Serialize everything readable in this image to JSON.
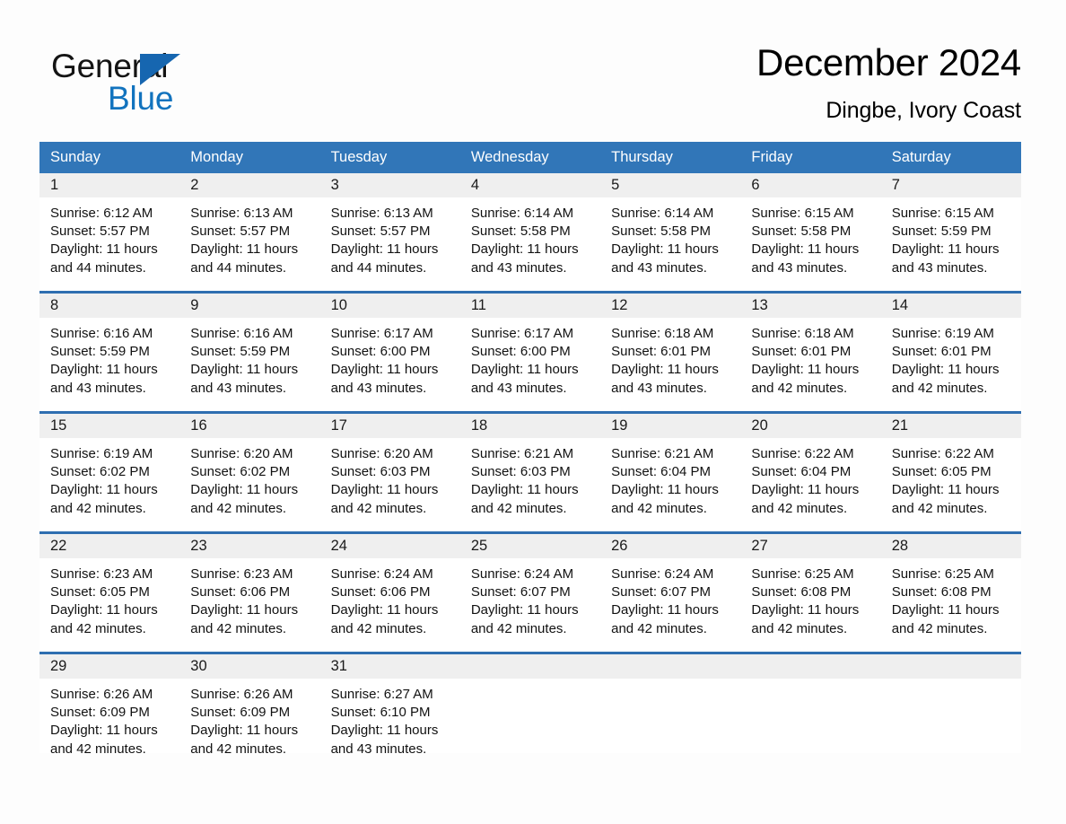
{
  "brand": {
    "name_part1": "General",
    "name_part2": "Blue",
    "triangle_color": "#1666b0",
    "blue_text_color": "#1273be"
  },
  "header": {
    "title": "December 2024",
    "subtitle": "Dingbe, Ivory Coast"
  },
  "theme": {
    "header_blue": "#3176b8",
    "row_separator_blue": "#2e6eb0",
    "daynum_band_gray": "#efefef",
    "page_background": "#fdfdfd"
  },
  "calendar": {
    "weekday_headers": [
      "Sunday",
      "Monday",
      "Tuesday",
      "Wednesday",
      "Thursday",
      "Friday",
      "Saturday"
    ],
    "weeks": [
      [
        {
          "day": "1",
          "sunrise": "Sunrise: 6:12 AM",
          "sunset": "Sunset: 5:57 PM",
          "daylight_line1": "Daylight: 11 hours",
          "daylight_line2": "and 44 minutes."
        },
        {
          "day": "2",
          "sunrise": "Sunrise: 6:13 AM",
          "sunset": "Sunset: 5:57 PM",
          "daylight_line1": "Daylight: 11 hours",
          "daylight_line2": "and 44 minutes."
        },
        {
          "day": "3",
          "sunrise": "Sunrise: 6:13 AM",
          "sunset": "Sunset: 5:57 PM",
          "daylight_line1": "Daylight: 11 hours",
          "daylight_line2": "and 44 minutes."
        },
        {
          "day": "4",
          "sunrise": "Sunrise: 6:14 AM",
          "sunset": "Sunset: 5:58 PM",
          "daylight_line1": "Daylight: 11 hours",
          "daylight_line2": "and 43 minutes."
        },
        {
          "day": "5",
          "sunrise": "Sunrise: 6:14 AM",
          "sunset": "Sunset: 5:58 PM",
          "daylight_line1": "Daylight: 11 hours",
          "daylight_line2": "and 43 minutes."
        },
        {
          "day": "6",
          "sunrise": "Sunrise: 6:15 AM",
          "sunset": "Sunset: 5:58 PM",
          "daylight_line1": "Daylight: 11 hours",
          "daylight_line2": "and 43 minutes."
        },
        {
          "day": "7",
          "sunrise": "Sunrise: 6:15 AM",
          "sunset": "Sunset: 5:59 PM",
          "daylight_line1": "Daylight: 11 hours",
          "daylight_line2": "and 43 minutes."
        }
      ],
      [
        {
          "day": "8",
          "sunrise": "Sunrise: 6:16 AM",
          "sunset": "Sunset: 5:59 PM",
          "daylight_line1": "Daylight: 11 hours",
          "daylight_line2": "and 43 minutes."
        },
        {
          "day": "9",
          "sunrise": "Sunrise: 6:16 AM",
          "sunset": "Sunset: 5:59 PM",
          "daylight_line1": "Daylight: 11 hours",
          "daylight_line2": "and 43 minutes."
        },
        {
          "day": "10",
          "sunrise": "Sunrise: 6:17 AM",
          "sunset": "Sunset: 6:00 PM",
          "daylight_line1": "Daylight: 11 hours",
          "daylight_line2": "and 43 minutes."
        },
        {
          "day": "11",
          "sunrise": "Sunrise: 6:17 AM",
          "sunset": "Sunset: 6:00 PM",
          "daylight_line1": "Daylight: 11 hours",
          "daylight_line2": "and 43 minutes."
        },
        {
          "day": "12",
          "sunrise": "Sunrise: 6:18 AM",
          "sunset": "Sunset: 6:01 PM",
          "daylight_line1": "Daylight: 11 hours",
          "daylight_line2": "and 43 minutes."
        },
        {
          "day": "13",
          "sunrise": "Sunrise: 6:18 AM",
          "sunset": "Sunset: 6:01 PM",
          "daylight_line1": "Daylight: 11 hours",
          "daylight_line2": "and 42 minutes."
        },
        {
          "day": "14",
          "sunrise": "Sunrise: 6:19 AM",
          "sunset": "Sunset: 6:01 PM",
          "daylight_line1": "Daylight: 11 hours",
          "daylight_line2": "and 42 minutes."
        }
      ],
      [
        {
          "day": "15",
          "sunrise": "Sunrise: 6:19 AM",
          "sunset": "Sunset: 6:02 PM",
          "daylight_line1": "Daylight: 11 hours",
          "daylight_line2": "and 42 minutes."
        },
        {
          "day": "16",
          "sunrise": "Sunrise: 6:20 AM",
          "sunset": "Sunset: 6:02 PM",
          "daylight_line1": "Daylight: 11 hours",
          "daylight_line2": "and 42 minutes."
        },
        {
          "day": "17",
          "sunrise": "Sunrise: 6:20 AM",
          "sunset": "Sunset: 6:03 PM",
          "daylight_line1": "Daylight: 11 hours",
          "daylight_line2": "and 42 minutes."
        },
        {
          "day": "18",
          "sunrise": "Sunrise: 6:21 AM",
          "sunset": "Sunset: 6:03 PM",
          "daylight_line1": "Daylight: 11 hours",
          "daylight_line2": "and 42 minutes."
        },
        {
          "day": "19",
          "sunrise": "Sunrise: 6:21 AM",
          "sunset": "Sunset: 6:04 PM",
          "daylight_line1": "Daylight: 11 hours",
          "daylight_line2": "and 42 minutes."
        },
        {
          "day": "20",
          "sunrise": "Sunrise: 6:22 AM",
          "sunset": "Sunset: 6:04 PM",
          "daylight_line1": "Daylight: 11 hours",
          "daylight_line2": "and 42 minutes."
        },
        {
          "day": "21",
          "sunrise": "Sunrise: 6:22 AM",
          "sunset": "Sunset: 6:05 PM",
          "daylight_line1": "Daylight: 11 hours",
          "daylight_line2": "and 42 minutes."
        }
      ],
      [
        {
          "day": "22",
          "sunrise": "Sunrise: 6:23 AM",
          "sunset": "Sunset: 6:05 PM",
          "daylight_line1": "Daylight: 11 hours",
          "daylight_line2": "and 42 minutes."
        },
        {
          "day": "23",
          "sunrise": "Sunrise: 6:23 AM",
          "sunset": "Sunset: 6:06 PM",
          "daylight_line1": "Daylight: 11 hours",
          "daylight_line2": "and 42 minutes."
        },
        {
          "day": "24",
          "sunrise": "Sunrise: 6:24 AM",
          "sunset": "Sunset: 6:06 PM",
          "daylight_line1": "Daylight: 11 hours",
          "daylight_line2": "and 42 minutes."
        },
        {
          "day": "25",
          "sunrise": "Sunrise: 6:24 AM",
          "sunset": "Sunset: 6:07 PM",
          "daylight_line1": "Daylight: 11 hours",
          "daylight_line2": "and 42 minutes."
        },
        {
          "day": "26",
          "sunrise": "Sunrise: 6:24 AM",
          "sunset": "Sunset: 6:07 PM",
          "daylight_line1": "Daylight: 11 hours",
          "daylight_line2": "and 42 minutes."
        },
        {
          "day": "27",
          "sunrise": "Sunrise: 6:25 AM",
          "sunset": "Sunset: 6:08 PM",
          "daylight_line1": "Daylight: 11 hours",
          "daylight_line2": "and 42 minutes."
        },
        {
          "day": "28",
          "sunrise": "Sunrise: 6:25 AM",
          "sunset": "Sunset: 6:08 PM",
          "daylight_line1": "Daylight: 11 hours",
          "daylight_line2": "and 42 minutes."
        }
      ],
      [
        {
          "day": "29",
          "sunrise": "Sunrise: 6:26 AM",
          "sunset": "Sunset: 6:09 PM",
          "daylight_line1": "Daylight: 11 hours",
          "daylight_line2": "and 42 minutes."
        },
        {
          "day": "30",
          "sunrise": "Sunrise: 6:26 AM",
          "sunset": "Sunset: 6:09 PM",
          "daylight_line1": "Daylight: 11 hours",
          "daylight_line2": "and 42 minutes."
        },
        {
          "day": "31",
          "sunrise": "Sunrise: 6:27 AM",
          "sunset": "Sunset: 6:10 PM",
          "daylight_line1": "Daylight: 11 hours",
          "daylight_line2": "and 43 minutes."
        },
        {
          "day": "",
          "sunrise": "",
          "sunset": "",
          "daylight_line1": "",
          "daylight_line2": ""
        },
        {
          "day": "",
          "sunrise": "",
          "sunset": "",
          "daylight_line1": "",
          "daylight_line2": ""
        },
        {
          "day": "",
          "sunrise": "",
          "sunset": "",
          "daylight_line1": "",
          "daylight_line2": ""
        },
        {
          "day": "",
          "sunrise": "",
          "sunset": "",
          "daylight_line1": "",
          "daylight_line2": ""
        }
      ]
    ]
  }
}
